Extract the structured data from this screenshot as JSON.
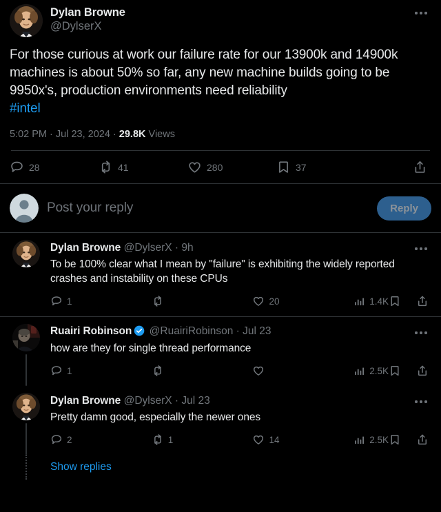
{
  "main_tweet": {
    "author_name": "Dylan Browne",
    "author_handle": "@DylserX",
    "body_line1": "For those curious at work our failure rate for our 13900k and 14900k",
    "body_line2": "machines is about 50% so far, any new machine builds going to be",
    "body_line3": "9950x's, production environments need reliability",
    "hashtag": "#intel",
    "time": "5:02 PM",
    "date": "Jul 23, 2024",
    "views_count": "29.8K",
    "views_label": "Views",
    "meta_sep": " · ",
    "actions": {
      "replies": "28",
      "retweets": "41",
      "likes": "280",
      "bookmarks": "37"
    }
  },
  "composer": {
    "placeholder": "Post your reply",
    "button_label": "Reply"
  },
  "replies": [
    {
      "name": "Dylan Browne",
      "handle": "@DylserX",
      "separator": " · ",
      "timestamp": "9h",
      "verified": false,
      "text": "To be 100% clear what I mean by \"failure\" is exhibiting the widely reported crashes and instability on these CPUs",
      "actions": {
        "replies": "1",
        "retweets": "",
        "likes": "20",
        "views": "1.4K"
      }
    },
    {
      "name": "Ruairi Robinson",
      "handle": "@RuairiRobinson",
      "separator": " · ",
      "timestamp": "Jul 23",
      "verified": true,
      "text": "how are they for single thread performance",
      "actions": {
        "replies": "1",
        "retweets": "",
        "likes": "",
        "views": "2.5K"
      }
    },
    {
      "name": "Dylan Browne",
      "handle": "@DylserX",
      "separator": " · ",
      "timestamp": "Jul 23",
      "verified": false,
      "text": "Pretty damn good, especially the newer ones",
      "actions": {
        "replies": "2",
        "retweets": "1",
        "likes": "14",
        "views": "2.5K"
      }
    }
  ],
  "show_replies_label": "Show replies",
  "colors": {
    "background": "#000000",
    "text_primary": "#e7e9ea",
    "text_secondary": "#71767b",
    "accent_blue": "#1d9bf0",
    "verified_blue": "#1d9bf0",
    "divider": "#2f3336",
    "reply_button_bg": "#2d5f8e"
  },
  "icons": {
    "more": "more-horizontal-icon",
    "reply": "reply-bubble-icon",
    "retweet": "retweet-icon",
    "like": "heart-icon",
    "bookmark": "bookmark-icon",
    "share": "share-icon",
    "views": "analytics-bars-icon",
    "verified": "verified-badge-icon"
  }
}
